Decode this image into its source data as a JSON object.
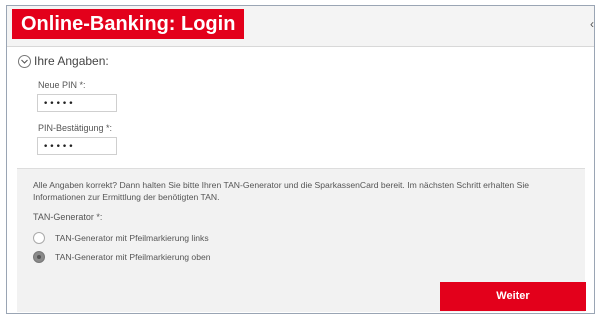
{
  "header": {
    "title": "Online-Banking: Login",
    "collapse_glyph": "‹"
  },
  "form": {
    "section_title": "Ihre Angaben:",
    "toggle_icon": "circle-chevron-down-icon",
    "neue_pin": {
      "label": "Neue PIN *:",
      "value": "•••••"
    },
    "pin_bestaetigung": {
      "label": "PIN-Bestätigung *:",
      "value": "•••••"
    }
  },
  "info": {
    "text": "Alle Angaben korrekt? Dann halten Sie bitte Ihren TAN-Generator und die SparkassenCard bereit. Im nächsten Schritt erhalten Sie Informationen zur Ermittlung der benötigten TAN.",
    "tan_label": "TAN-Generator *:",
    "options": [
      {
        "label": "TAN-Generator mit Pfeilmarkierung links",
        "selected": false
      },
      {
        "label": "TAN-Generator mit Pfeilmarkierung oben",
        "selected": true
      }
    ],
    "submit_label": "Weiter"
  },
  "colors": {
    "brand_red": "#e3001b",
    "panel_gray": "#f2f2f2"
  }
}
